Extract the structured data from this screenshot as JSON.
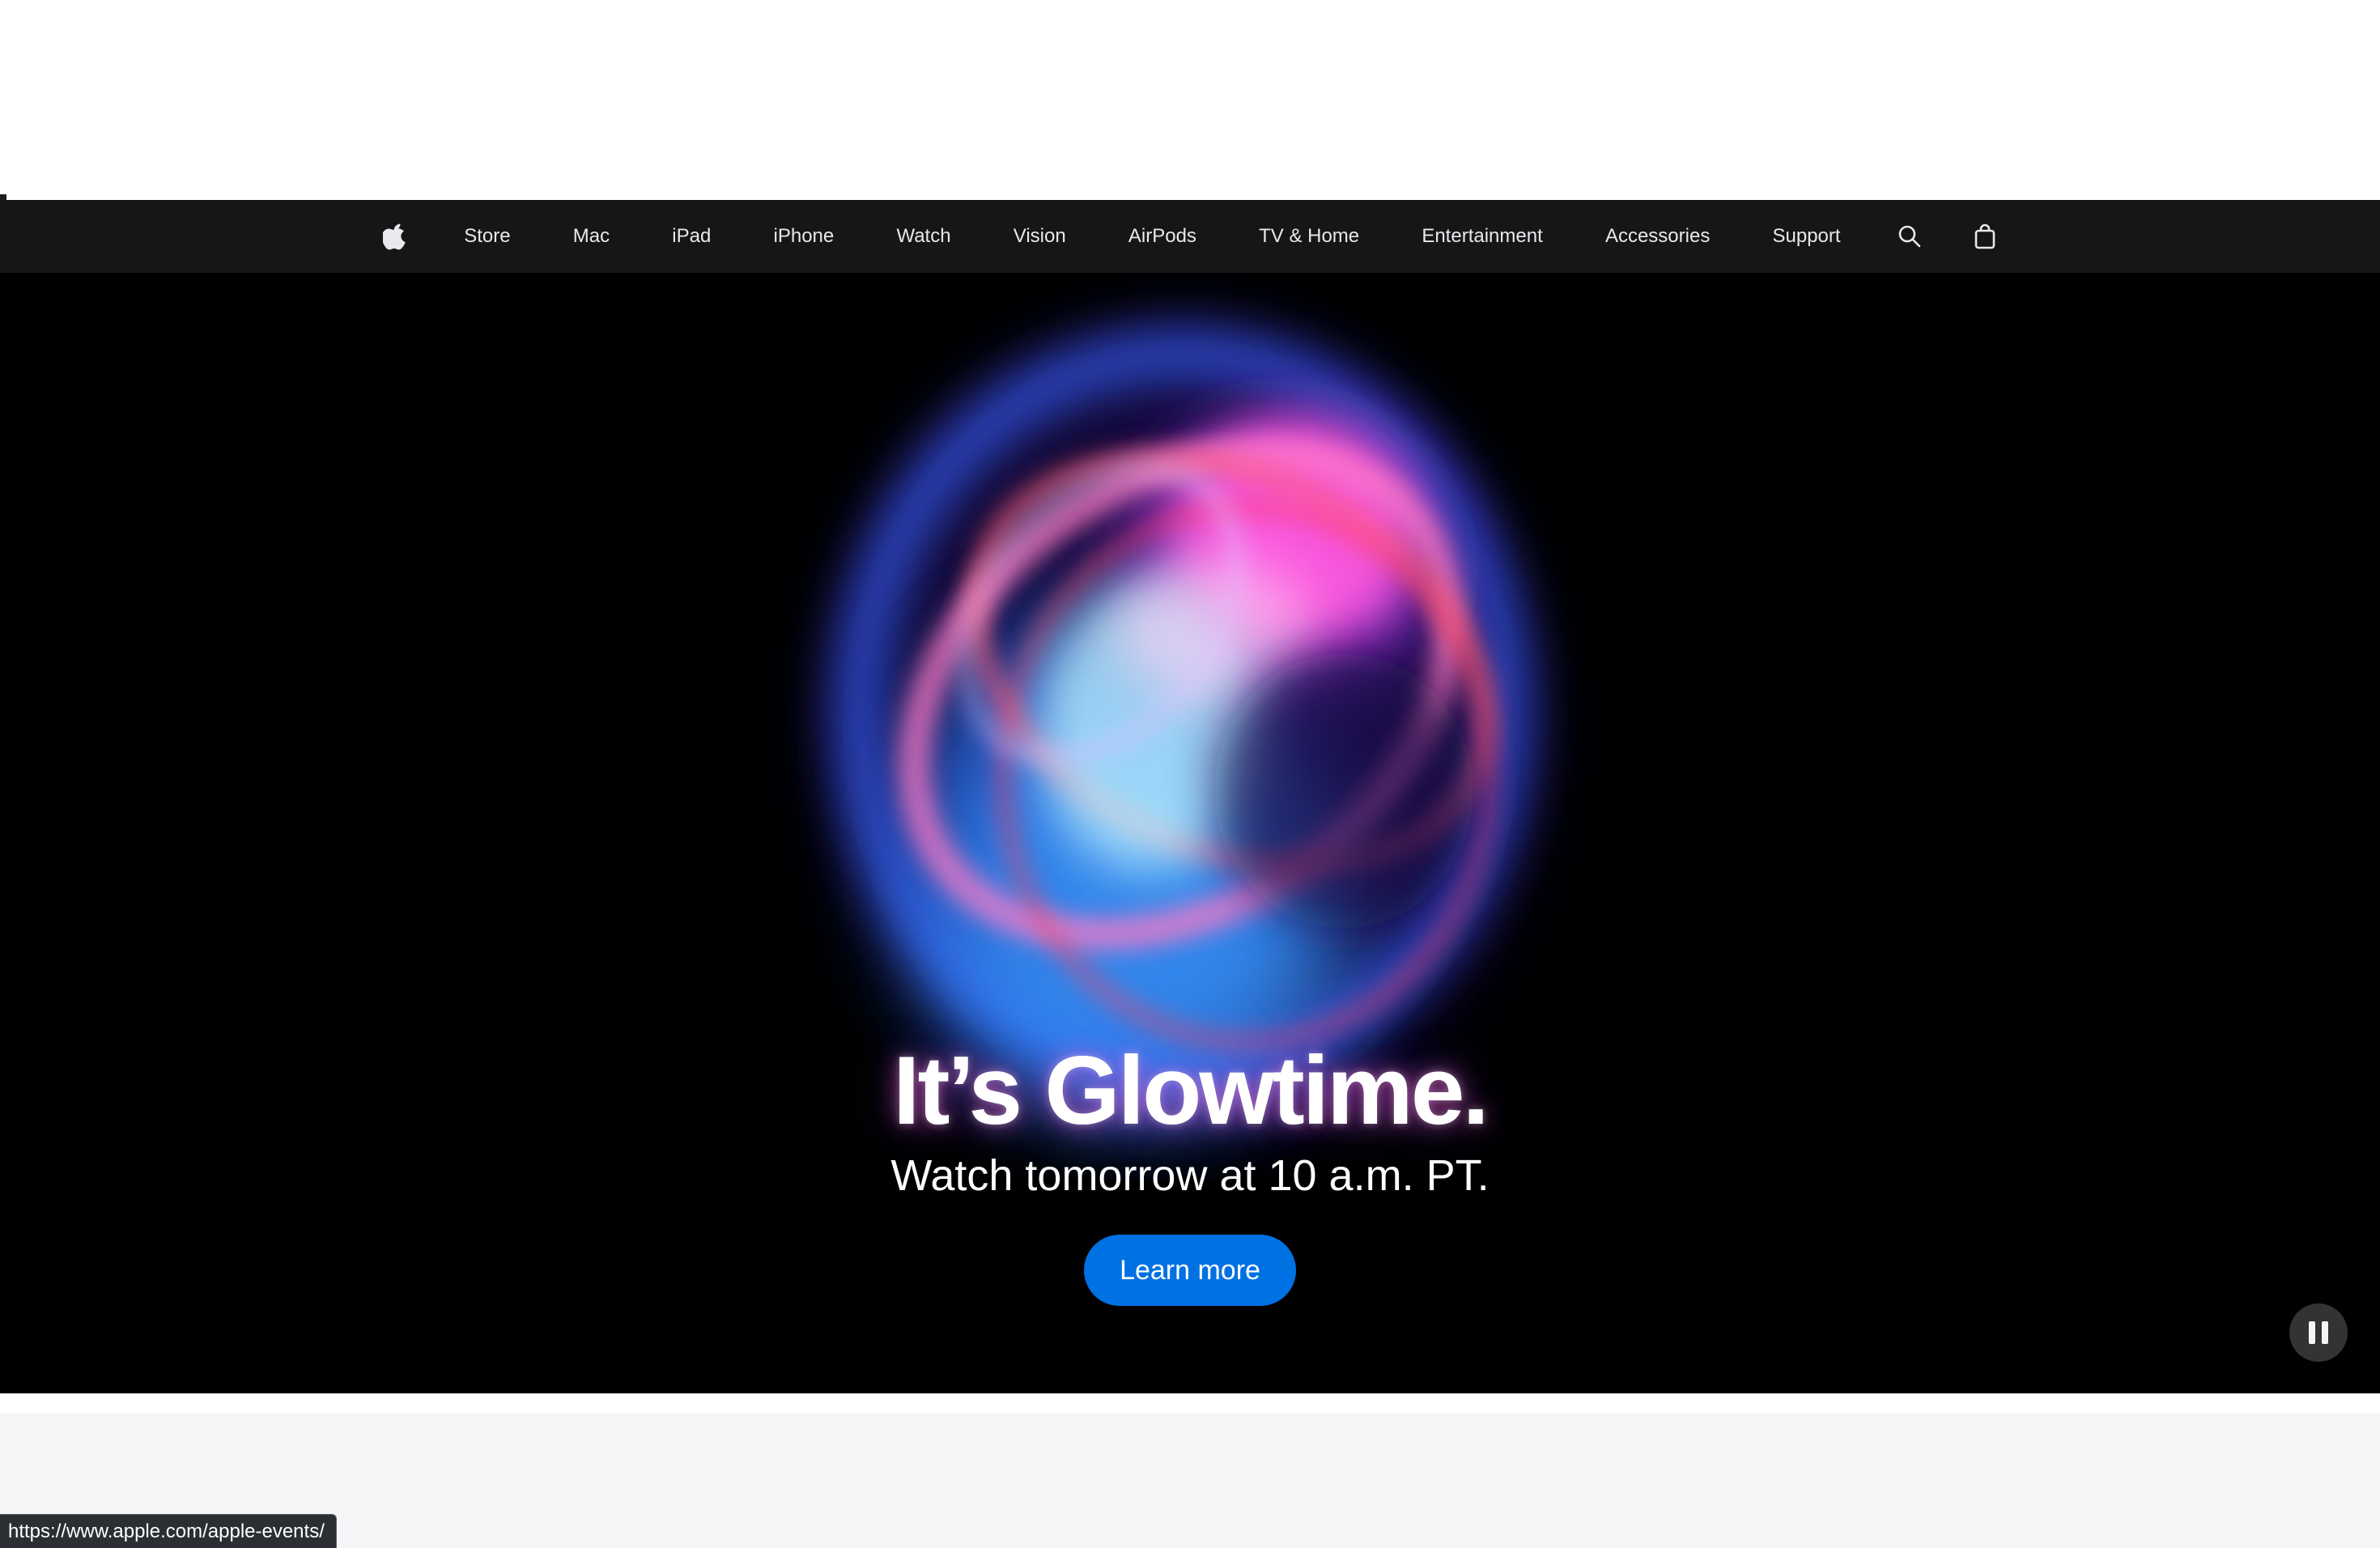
{
  "nav": {
    "items": [
      {
        "label": "Store"
      },
      {
        "label": "Mac"
      },
      {
        "label": "iPad"
      },
      {
        "label": "iPhone"
      },
      {
        "label": "Watch"
      },
      {
        "label": "Vision"
      },
      {
        "label": "AirPods"
      },
      {
        "label": "TV & Home"
      },
      {
        "label": "Entertainment"
      },
      {
        "label": "Accessories"
      },
      {
        "label": "Support"
      }
    ],
    "icons": {
      "logo": "apple-logo-icon",
      "search": "search-icon",
      "bag": "bag-icon"
    },
    "background": "#161617",
    "text_color": "#e8e8ed"
  },
  "hero": {
    "headline": "It’s Glowtime.",
    "subhead": "Watch tomorrow at 10 a.m. PT.",
    "cta_label": "Learn more",
    "cta_color": "#0071e3",
    "pause_icon": "pause-icon",
    "background": "#000000"
  },
  "status_bar": {
    "url": "https://www.apple.com/apple-events/"
  },
  "colors": {
    "lower_section": "#f5f5f7"
  }
}
